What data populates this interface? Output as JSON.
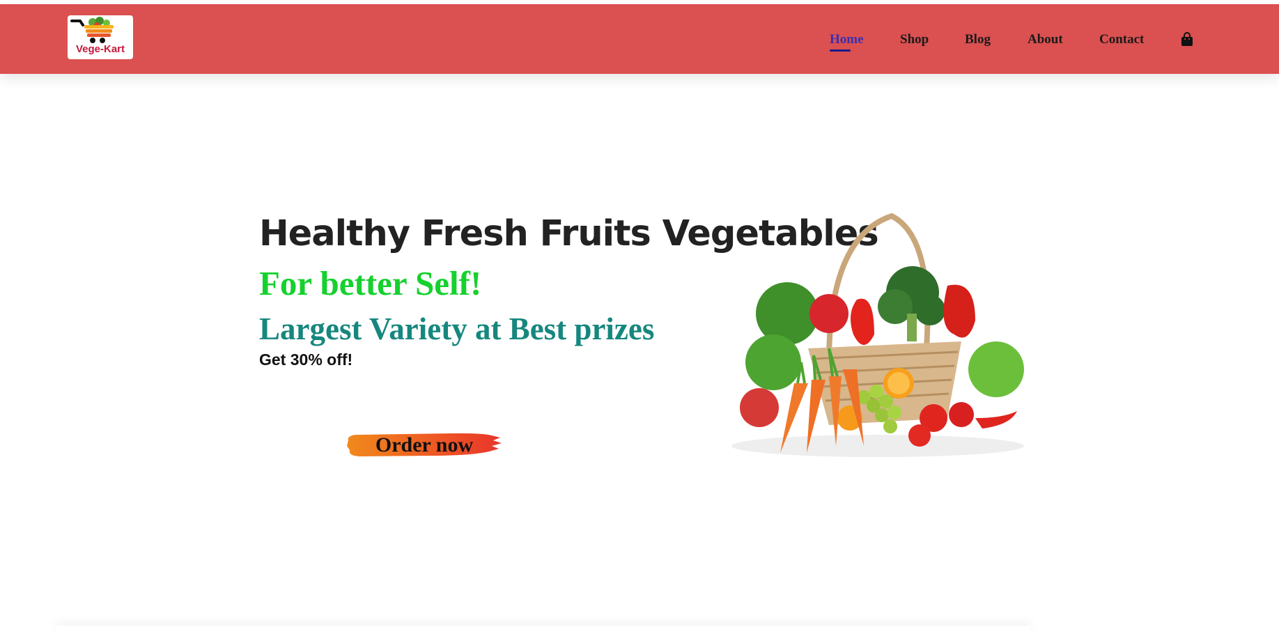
{
  "brand": {
    "logo_text": "Vege-Kart"
  },
  "nav": {
    "items": [
      {
        "label": "Home",
        "active": true
      },
      {
        "label": "Shop",
        "active": false
      },
      {
        "label": "Blog",
        "active": false
      },
      {
        "label": "About",
        "active": false
      },
      {
        "label": "Contact",
        "active": false
      }
    ],
    "cart_icon": "shopping-bag-icon"
  },
  "hero": {
    "title": "Healthy Fresh Fruits Vegetables",
    "subtitle": "For better Self!",
    "tagline": "Largest Variety at Best prizes",
    "offer": "Get 30% off!",
    "cta_label": "Order now",
    "image_icon": "vegetable-basket-image"
  },
  "colors": {
    "navbar": "#db5050",
    "subtitle": "#15d12e",
    "tagline": "#16877e",
    "cta_brush_start": "#f08a1c",
    "cta_brush_end": "#e8352a",
    "active_nav": "#3a2fb0"
  }
}
